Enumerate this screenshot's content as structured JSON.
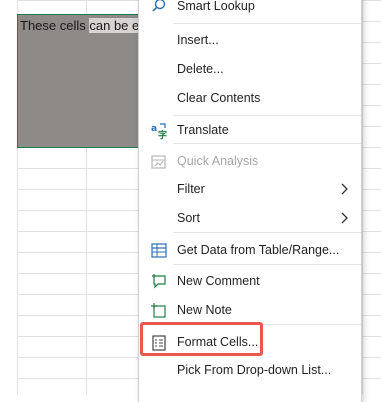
{
  "sheet": {
    "cell_text_normal": "These cells ",
    "cell_text_highlight": "can be ed"
  },
  "menu": {
    "items": [
      {
        "label": "Smart Lookup",
        "icon": "search-icon"
      },
      {
        "label": "Insert...",
        "icon": ""
      },
      {
        "label": "Delete...",
        "icon": ""
      },
      {
        "label": "Clear Contents",
        "icon": ""
      },
      {
        "label": "Translate",
        "icon": "translate-icon"
      },
      {
        "label": "Quick Analysis",
        "icon": "quick-analysis-icon",
        "disabled": true
      },
      {
        "label": "Filter",
        "icon": "",
        "submenu": true
      },
      {
        "label": "Sort",
        "icon": "",
        "submenu": true
      },
      {
        "label": "Get Data from Table/Range...",
        "icon": "table-icon"
      },
      {
        "label": "New Comment",
        "icon": "new-comment-icon"
      },
      {
        "label": "New Note",
        "icon": "new-note-icon"
      },
      {
        "label": "Format Cells...",
        "icon": "format-cells-icon",
        "highlighted": true
      },
      {
        "label": "Pick From Drop-down List...",
        "icon": ""
      }
    ]
  },
  "colors": {
    "highlight_border": "#e8584d",
    "selection_fill": "#8e8a88",
    "selection_border": "#1e7d45",
    "disabled_text": "#a6a6a6"
  }
}
